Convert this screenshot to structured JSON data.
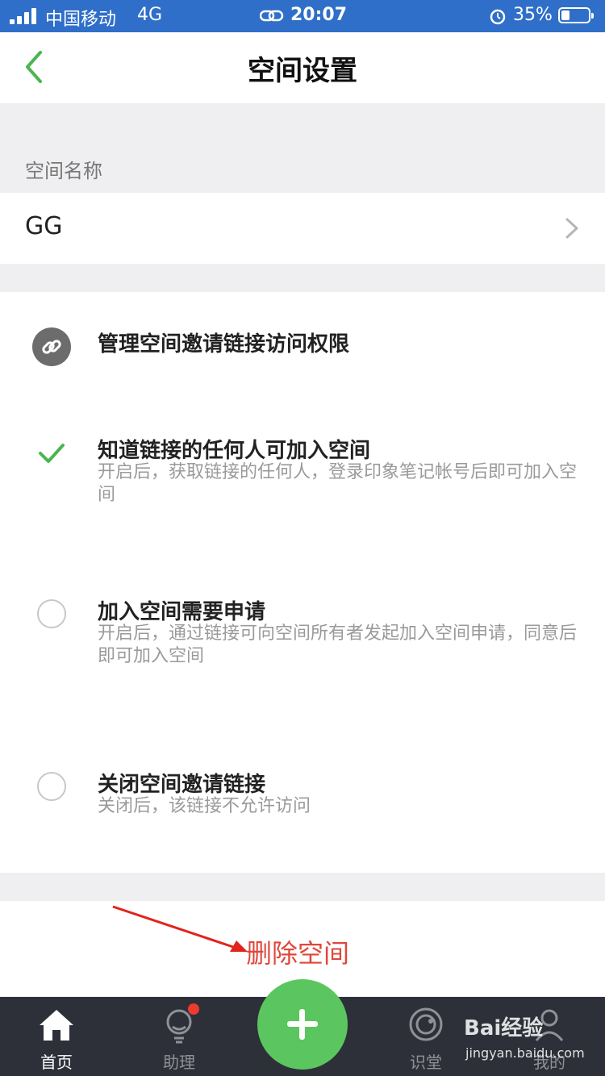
{
  "status_bar": {
    "carrier": "中国移动",
    "network": "4G",
    "time": "20:07",
    "battery_percent": "35%"
  },
  "nav": {
    "title": "空间设置"
  },
  "space_name": {
    "section_label": "空间名称",
    "value": "GG"
  },
  "permissions": {
    "header": "管理空间邀请链接访问权限",
    "options": [
      {
        "title": "知道链接的任何人可加入空间",
        "description": "开启后，获取链接的任何人，登录印象笔记帐号后即可加入空间",
        "selected": true
      },
      {
        "title": "加入空间需要申请",
        "description": "开启后，通过链接可向空间所有者发起加入空间申请，同意后即可加入空间",
        "selected": false
      },
      {
        "title": "关闭空间邀请链接",
        "description": "关闭后，该链接不允许访问",
        "selected": false
      }
    ]
  },
  "delete_button": {
    "label": "删除空间"
  },
  "tab_bar": {
    "tabs": [
      {
        "label": "首页",
        "icon": "home-icon",
        "active": true
      },
      {
        "label": "助理",
        "icon": "lightbulb-icon",
        "active": false
      },
      {
        "label": "识堂",
        "icon": "smiley-icon",
        "active": false
      },
      {
        "label": "我的",
        "icon": "person-icon",
        "active": false
      }
    ]
  },
  "watermark": {
    "brand": "Bai经验",
    "url": "jingyan.baidu.com"
  },
  "colors": {
    "accent_green": "#5bc65f",
    "delete_red": "#e0463a",
    "status_bar_blue": "#2f6fc9",
    "tab_bar_bg": "#2d3038"
  }
}
